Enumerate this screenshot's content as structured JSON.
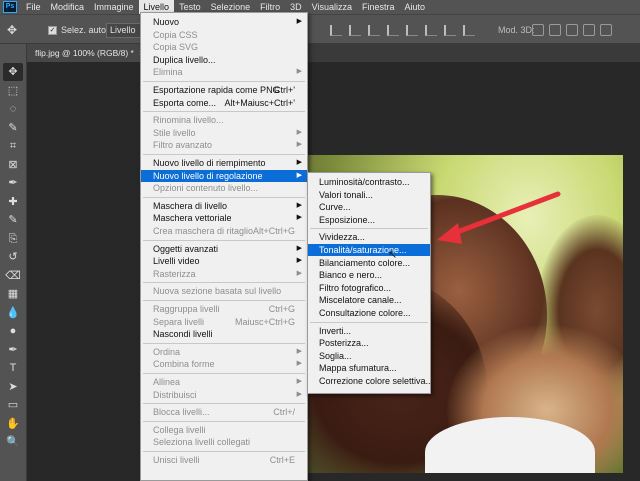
{
  "app": {
    "logo": "Ps"
  },
  "menubar": {
    "items": [
      "File",
      "Modifica",
      "Immagine",
      "Livello",
      "Testo",
      "Selezione",
      "Filtro",
      "3D",
      "Visualizza",
      "Finestra",
      "Aiuto"
    ],
    "active": "Livello"
  },
  "options": {
    "move_icon": "move-tool-icon",
    "auto_select_label": "Selez. auto:",
    "auto_select_value": "Livello",
    "mode_3d_label": "Mod. 3D:"
  },
  "document_tab": {
    "title": "flip.jpg @ 100% (RGB/8) *",
    "close": "×"
  },
  "tools": [
    "move-tool-icon",
    "marquee-icon",
    "lasso-icon",
    "quick-select-icon",
    "crop-icon",
    "frame-icon",
    "eyedropper-icon",
    "healing-brush-icon",
    "brush-icon",
    "clone-stamp-icon",
    "history-brush-icon",
    "eraser-icon",
    "gradient-icon",
    "blur-icon",
    "dodge-icon",
    "pen-icon",
    "type-icon",
    "path-select-icon",
    "rectangle-icon",
    "hand-icon",
    "zoom-icon"
  ],
  "livello_menu": {
    "items": [
      {
        "label": "Nuovo",
        "submenu": true
      },
      {
        "label": "Copia CSS",
        "disabled": true
      },
      {
        "label": "Copia SVG",
        "disabled": true
      },
      {
        "label": "Duplica livello..."
      },
      {
        "label": "Elimina",
        "disabled": true,
        "submenu": true
      },
      {
        "separator": true
      },
      {
        "label": "Esportazione rapida come PNG",
        "shortcut": "Ctrl+'"
      },
      {
        "label": "Esporta come...",
        "shortcut": "Alt+Maiusc+Ctrl+'"
      },
      {
        "separator": true
      },
      {
        "label": "Rinomina livello...",
        "disabled": true
      },
      {
        "label": "Stile livello",
        "disabled": true,
        "submenu": true
      },
      {
        "label": "Filtro avanzato",
        "disabled": true,
        "submenu": true
      },
      {
        "separator": true
      },
      {
        "label": "Nuovo livello di riempimento",
        "submenu": true
      },
      {
        "label": "Nuovo livello di regolazione",
        "submenu": true,
        "highlighted": true
      },
      {
        "label": "Opzioni contenuto livello...",
        "disabled": true
      },
      {
        "separator": true
      },
      {
        "label": "Maschera di livello",
        "submenu": true
      },
      {
        "label": "Maschera vettoriale",
        "submenu": true
      },
      {
        "label": "Crea maschera di ritaglio",
        "disabled": true,
        "shortcut": "Alt+Ctrl+G"
      },
      {
        "separator": true
      },
      {
        "label": "Oggetti avanzati",
        "submenu": true
      },
      {
        "label": "Livelli video",
        "submenu": true
      },
      {
        "label": "Rasterizza",
        "disabled": true,
        "submenu": true
      },
      {
        "separator": true
      },
      {
        "label": "Nuova sezione basata sul livello",
        "disabled": true
      },
      {
        "separator": true
      },
      {
        "label": "Raggruppa livelli",
        "disabled": true,
        "shortcut": "Ctrl+G"
      },
      {
        "label": "Separa livelli",
        "disabled": true,
        "shortcut": "Maiusc+Ctrl+G"
      },
      {
        "label": "Nascondi livelli"
      },
      {
        "separator": true
      },
      {
        "label": "Ordina",
        "disabled": true,
        "submenu": true
      },
      {
        "label": "Combina forme",
        "disabled": true,
        "submenu": true
      },
      {
        "separator": true
      },
      {
        "label": "Allinea",
        "disabled": true,
        "submenu": true
      },
      {
        "label": "Distribuisci",
        "disabled": true,
        "submenu": true
      },
      {
        "separator": true
      },
      {
        "label": "Blocca livelli...",
        "disabled": true,
        "shortcut": "Ctrl+/"
      },
      {
        "separator": true
      },
      {
        "label": "Collega livelli",
        "disabled": true
      },
      {
        "label": "Seleziona livelli collegati",
        "disabled": true
      },
      {
        "separator": true
      },
      {
        "label": "Unisci livelli",
        "disabled": true,
        "shortcut": "Ctrl+E"
      }
    ]
  },
  "regolazione_submenu": {
    "items": [
      {
        "label": "Luminosità/contrasto..."
      },
      {
        "label": "Valori tonali..."
      },
      {
        "label": "Curve..."
      },
      {
        "label": "Esposizione..."
      },
      {
        "separator": true
      },
      {
        "label": "Vividezza..."
      },
      {
        "label": "Tonalità/saturazione...",
        "highlighted": true
      },
      {
        "label": "Bilanciamento colore..."
      },
      {
        "label": "Bianco e nero..."
      },
      {
        "label": "Filtro fotografico..."
      },
      {
        "label": "Miscelatore canale..."
      },
      {
        "label": "Consultazione colore..."
      },
      {
        "separator": true
      },
      {
        "label": "Inverti..."
      },
      {
        "label": "Posterizza..."
      },
      {
        "label": "Soglia..."
      },
      {
        "label": "Mappa sfumatura..."
      },
      {
        "label": "Correzione colore selettiva..."
      }
    ]
  },
  "colors": {
    "highlight": "#0b6ed8",
    "annotation_arrow": "#e8303a"
  }
}
